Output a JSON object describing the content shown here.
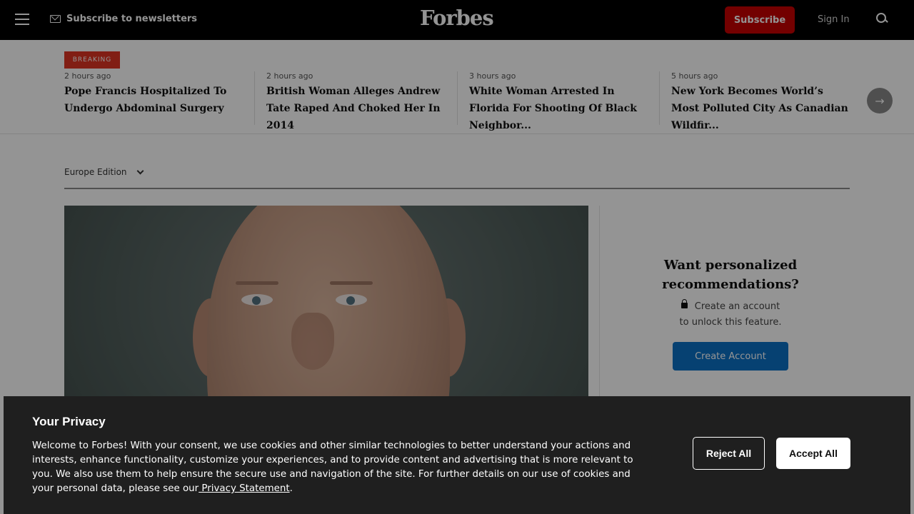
{
  "header": {
    "newsletter_label": "Subscribe to newsletters",
    "logo_text": "Forbes",
    "subscribe_label": "Subscribe",
    "signin_label": "Sign In",
    "icons": {
      "menu": "hamburger-menu-icon",
      "mail": "mail-icon",
      "search": "search-icon"
    }
  },
  "breaking": {
    "badge_label": "BREAKING",
    "stories": [
      {
        "time": "2 hours ago",
        "title": "Pope Francis Hospitalized To Undergo Abdominal Surgery"
      },
      {
        "time": "2 hours ago",
        "title": "British Woman Alleges Andrew Tate Raped And Choked Her In 2014"
      },
      {
        "time": "3 hours ago",
        "title": "White Woman Arrested In Florida For Shooting Of Black Neighbor..."
      },
      {
        "time": "5 hours ago",
        "title": "New York Becomes World’s Most Polluted City As Canadian Wildfir..."
      }
    ],
    "next_icon": "arrow-right-icon"
  },
  "edition": {
    "label": "Europe Edition"
  },
  "recommend": {
    "title": "Want personalized recommendations?",
    "text_line1": "Create an account",
    "text_line2": "to unlock this feature.",
    "button_label": "Create Account"
  },
  "privacy": {
    "title": "Your Privacy",
    "body": "Welcome to Forbes! With your consent, we use cookies and other similar technologies to better understand your actions and interests, enhance functionality, customize your experiences, and to provide content and advertising that is more relevant to you. We also use them to help ensure the secure use and navigation of the site. For further details on our use of cookies and your personal data, please see our",
    "link_label": " Privacy Statement",
    "period": ".",
    "reject_label": "Reject All",
    "accept_label": "Accept All"
  },
  "colors": {
    "header_bg": "#000000",
    "subscribe_bg": "#c60000",
    "breaking_badge": "#de3523",
    "create_account_bg": "#0b70c4",
    "privacy_bg": "#1f1f1f"
  }
}
